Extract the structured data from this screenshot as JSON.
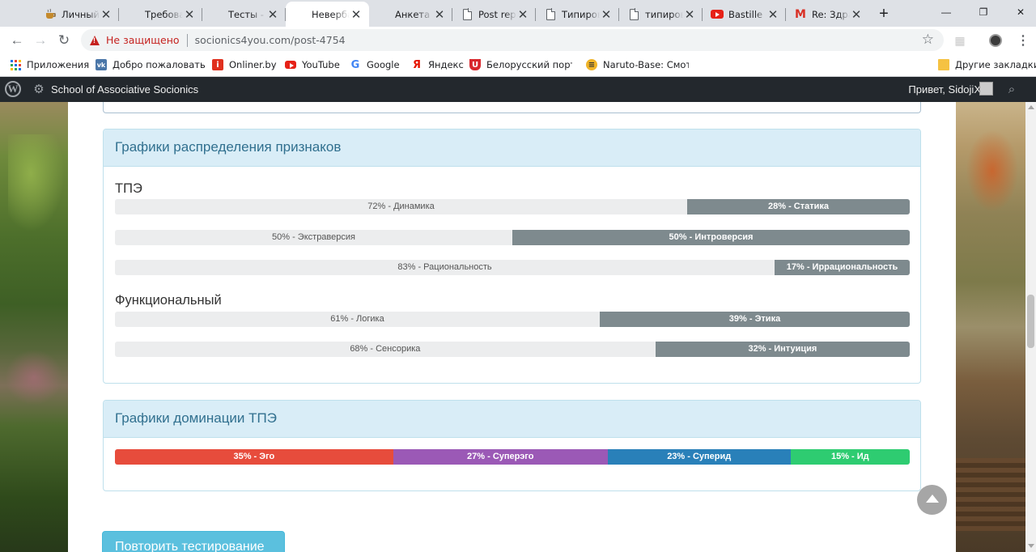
{
  "browser": {
    "tabs": [
      {
        "title": "Личный",
        "favicon": "tea-icon",
        "active": false
      },
      {
        "title": "Требова",
        "favicon": "none",
        "active": false
      },
      {
        "title": "Тесты - ",
        "favicon": "none",
        "active": false
      },
      {
        "title": "Невербал",
        "favicon": "none",
        "active": true
      },
      {
        "title": "Анкета - ",
        "favicon": "none",
        "active": false
      },
      {
        "title": "Post repl",
        "favicon": "document-icon",
        "active": false
      },
      {
        "title": "Типиров",
        "favicon": "document-icon",
        "active": false
      },
      {
        "title": "типиров",
        "favicon": "document-icon",
        "active": false
      },
      {
        "title": "Bastille - ",
        "favicon": "youtube-icon",
        "active": false
      },
      {
        "title": "Re: Здра",
        "favicon": "gmail-icon",
        "active": false
      }
    ],
    "new_tab": "+",
    "window_controls": {
      "minimize": "—",
      "maximize": "❐",
      "close": "✕"
    },
    "security_label": "Не защищено",
    "url": "socionics4you.com/post-4754",
    "bookmarks": [
      {
        "label": "Приложения",
        "icon": "apps-grid-icon"
      },
      {
        "label": "Добро пожаловать",
        "icon": "vk-icon"
      },
      {
        "label": "Onliner.by",
        "icon": "onliner-icon"
      },
      {
        "label": "YouTube",
        "icon": "youtube-icon"
      },
      {
        "label": "Google",
        "icon": "google-icon"
      },
      {
        "label": "Яндекс",
        "icon": "yandex-icon"
      },
      {
        "label": "Белорусский портал",
        "icon": "tut-by-icon"
      },
      {
        "label": "Naruto-Base: Смотри",
        "icon": "naruto-icon"
      }
    ],
    "other_bookmarks": "Другие закладки"
  },
  "adminbar": {
    "site_name": "School of Associative Socionics",
    "greeting": "Привет, SidojiX"
  },
  "distribution": {
    "title": "Графики распределения признаков",
    "groups": [
      {
        "title": "ТПЭ",
        "bars": [
          {
            "left": {
              "pct": 72,
              "label": "72% - Динамика"
            },
            "right": {
              "pct": 28,
              "label": "28% - Статика"
            }
          },
          {
            "left": {
              "pct": 50,
              "label": "50% - Экстраверсия"
            },
            "right": {
              "pct": 50,
              "label": "50% - Интроверсия"
            }
          },
          {
            "left": {
              "pct": 83,
              "label": "83% - Рациональность"
            },
            "right": {
              "pct": 17,
              "label": "17% - Иррациональность"
            }
          }
        ]
      },
      {
        "title": "Функциональный",
        "bars": [
          {
            "left": {
              "pct": 61,
              "label": "61% - Логика"
            },
            "right": {
              "pct": 39,
              "label": "39% - Этика"
            }
          },
          {
            "left": {
              "pct": 68,
              "label": "68% - Сенсорика"
            },
            "right": {
              "pct": 32,
              "label": "32% - Интуиция"
            }
          }
        ]
      }
    ]
  },
  "dominance": {
    "title": "Графики доминации ТПЭ",
    "segments": [
      {
        "pct": 35,
        "label": "35% - Эго",
        "color": "#e74c3c"
      },
      {
        "pct": 27,
        "label": "27% - Суперэго",
        "color": "#9b59b6"
      },
      {
        "pct": 23,
        "label": "23% - Суперид",
        "color": "#2980b9"
      },
      {
        "pct": 15,
        "label": "15% - Ид",
        "color": "#2ecc71"
      }
    ]
  },
  "retest_button": "Повторить тестирование"
}
